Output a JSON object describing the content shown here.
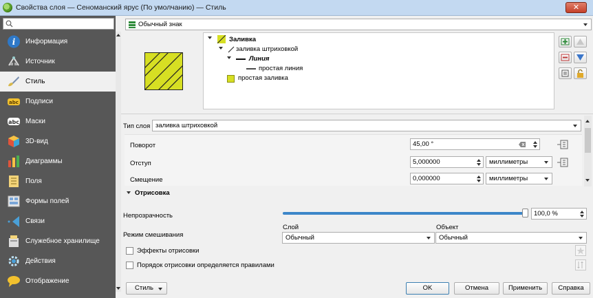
{
  "window": {
    "title": "Свойства слоя — Сеноманский ярус (По умолчанию) — Стиль",
    "close_label": "✕"
  },
  "sidebar": {
    "search_placeholder": "",
    "items": [
      {
        "label": "Информация",
        "icon": "info-icon"
      },
      {
        "label": "Источник",
        "icon": "source-icon"
      },
      {
        "label": "Стиль",
        "icon": "paintbrush-icon",
        "selected": true
      },
      {
        "label": "Подписи",
        "icon": "labels-abc-icon"
      },
      {
        "label": "Маски",
        "icon": "masks-abc-icon"
      },
      {
        "label": "3D-вид",
        "icon": "cube-3d-icon"
      },
      {
        "label": "Диаграммы",
        "icon": "diagram-icon"
      },
      {
        "label": "Поля",
        "icon": "fields-icon"
      },
      {
        "label": "Формы полей",
        "icon": "form-icon"
      },
      {
        "label": "Связи",
        "icon": "joins-icon"
      },
      {
        "label": "Служебное хранилище",
        "icon": "storage-icon"
      },
      {
        "label": "Действия",
        "icon": "actions-gear-icon"
      },
      {
        "label": "Отображение",
        "icon": "display-bubble-icon"
      }
    ]
  },
  "renderer": {
    "value": "Обычный знак"
  },
  "tree": {
    "fill": "Заливка",
    "hatch_fill": "заливка штриховкой",
    "line": "Линия",
    "simple_line": "простая линия",
    "simple_fill": "простая заливка"
  },
  "layer_type": {
    "label": "Тип слоя",
    "value": "заливка штриховкой"
  },
  "props": {
    "rotation": {
      "label": "Поворот",
      "value": "45,00 °"
    },
    "offset": {
      "label": "Отступ",
      "value": "5,000000",
      "unit": "миллиметры"
    },
    "displacement": {
      "label": "Смещение",
      "value": "0,000000",
      "unit": "миллиметры"
    }
  },
  "rendering": {
    "section_title": "Отрисовка",
    "opacity_label": "Непрозрачность",
    "opacity_value": "100,0 %",
    "opacity_level": 1.0,
    "blend_label": "Режим смешивания",
    "layer_label": "Слой",
    "layer_value": "Обычный",
    "object_label": "Объект",
    "object_value": "Обычный",
    "effects_label": "Эффекты отрисовки",
    "order_label": "Порядок отрисовки определяется правилами"
  },
  "footer": {
    "style_label": "Стиль",
    "ok_label": "OK",
    "cancel_label": "Отмена",
    "apply_label": "Применить",
    "help_label": "Справка"
  },
  "colors": {
    "sidebar_bg": "#575757",
    "hatch_fill": "#d7df23",
    "accent": "#3c7fb1"
  }
}
